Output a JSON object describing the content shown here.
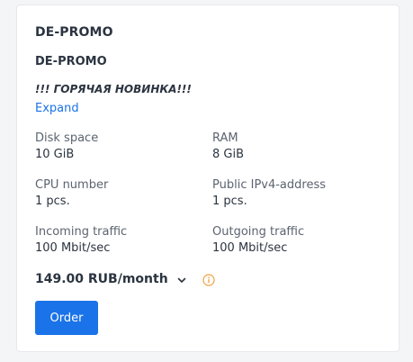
{
  "card": {
    "title": "DE-PROMO",
    "plan_name": "DE-PROMO",
    "promo_text": "!!! ГОРЯЧАЯ НОВИНКА!!!",
    "expand_label": "Expand"
  },
  "specs": {
    "disk": {
      "label": "Disk space",
      "value": "10 GiB"
    },
    "ram": {
      "label": "RAM",
      "value": "8 GiB"
    },
    "cpu": {
      "label": "CPU number",
      "value": "1 pcs."
    },
    "ipv4": {
      "label": "Public IPv4-address",
      "value": "1 pcs."
    },
    "incoming": {
      "label": "Incoming traffic",
      "value": "100 Mbit/sec"
    },
    "outgoing": {
      "label": "Outgoing traffic",
      "value": "100 Mbit/sec"
    }
  },
  "pricing": {
    "price": "149.00 RUB/month",
    "period_dropdown_icon": "chevron-down-icon",
    "info_icon": "info-icon",
    "info_color": "#f0a040"
  },
  "actions": {
    "order_label": "Order"
  },
  "colors": {
    "accent": "#1a73e8",
    "text": "#2b3440",
    "muted": "#5b6470"
  }
}
